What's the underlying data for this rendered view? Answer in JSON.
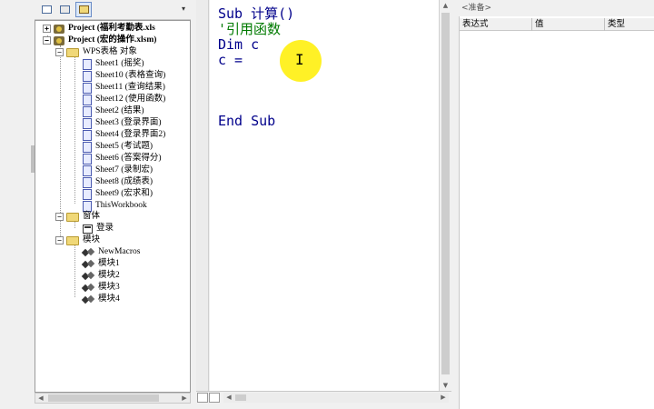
{
  "project_explorer": {
    "dropdown_arrow": "▾",
    "toolbar_icons": [
      "view-code-icon",
      "view-object-icon",
      "toggle-folders-icon"
    ],
    "projects": [
      {
        "label": "Project (福利考勤表.xls",
        "expander": "+"
      },
      {
        "label": "Project (宏的操作.xlsm)",
        "expander": "−"
      }
    ],
    "folders": {
      "objects": {
        "label": "WPS表格 对象",
        "expander": "−"
      },
      "forms": {
        "label": "窗体",
        "expander": "−"
      },
      "modules": {
        "label": "模块",
        "expander": "−"
      }
    },
    "sheets": [
      "Sheet1 (摇奖)",
      "Sheet10 (表格查询)",
      "Sheet11 (查询结果)",
      "Sheet12 (使用函数)",
      "Sheet2 (结果)",
      "Sheet3 (登录界面)",
      "Sheet4 (登录界面2)",
      "Sheet5 (考试题)",
      "Sheet6 (答案得分)",
      "Sheet7 (录制宏)",
      "Sheet8 (成绩表)",
      "Sheet9 (宏求和)",
      "ThisWorkbook"
    ],
    "forms": [
      "登录"
    ],
    "modules": [
      "NewMacros",
      "模块1",
      "模块2",
      "模块3",
      "模块4"
    ]
  },
  "code_window": {
    "lines": [
      {
        "text": "Sub 计算()",
        "kind": "keyword"
      },
      {
        "text": "'引用函数",
        "kind": "comment"
      },
      {
        "text": "Dim c",
        "kind": "keyword"
      },
      {
        "text": "c =",
        "kind": "keyword"
      },
      {
        "text": "",
        "kind": "keyword"
      },
      {
        "text": "",
        "kind": "keyword"
      },
      {
        "text": "End Sub",
        "kind": "keyword"
      }
    ],
    "text_cursor": "I",
    "colors": {
      "keyword": "#00008b",
      "comment": "#007a00",
      "cursor_highlight": "#ffee00"
    }
  },
  "watch_window": {
    "title": "<准备>",
    "columns": [
      "表达式",
      "值",
      "类型"
    ]
  }
}
